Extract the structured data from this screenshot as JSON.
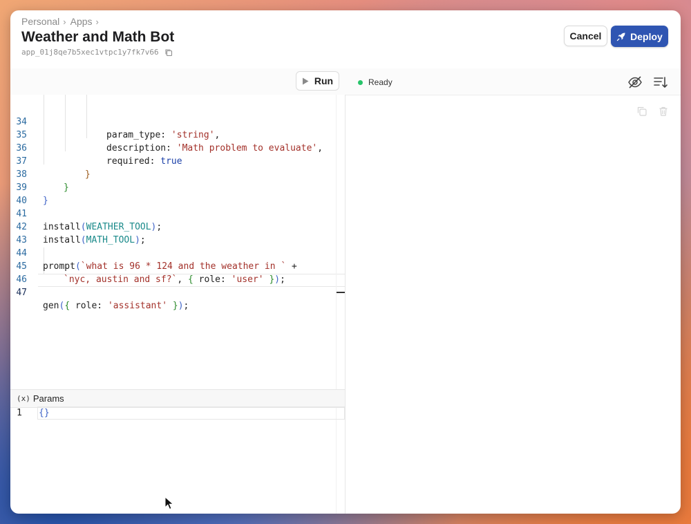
{
  "header": {
    "breadcrumbs": [
      "Personal",
      "Apps"
    ],
    "title": "Weather and Math Bot",
    "app_id": "app_01j8qe7b5xec1vtpc1y7fk7v66",
    "cancel_label": "Cancel",
    "deploy_label": "Deploy"
  },
  "toolbar": {
    "run_label": "Run",
    "status": "Ready",
    "status_color": "#27c46a"
  },
  "editor": {
    "lines": [
      {
        "num": "34",
        "code": "param_type: 'string',"
      },
      {
        "num": "35",
        "code": "description: 'Math problem to evaluate',"
      },
      {
        "num": "36",
        "code": "required: true"
      },
      {
        "num": "37",
        "code": "}"
      },
      {
        "num": "38",
        "code": "}"
      },
      {
        "num": "39",
        "code": "}"
      },
      {
        "num": "40",
        "code": ""
      },
      {
        "num": "41",
        "code": "install(WEATHER_TOOL);"
      },
      {
        "num": "42",
        "code": "install(MATH_TOOL);"
      },
      {
        "num": "43",
        "code": ""
      },
      {
        "num": "44",
        "code": "prompt(`what is 96 * 124 and the weather in ` +"
      },
      {
        "num": "45",
        "code": "`nyc, austin and sf?`, { role: 'user' });"
      },
      {
        "num": "46",
        "code": ""
      },
      {
        "num": "47",
        "code": "gen({ role: 'assistant' });"
      }
    ]
  },
  "params": {
    "title": "Params",
    "prefix_glyph": "(x)",
    "line_num": "1",
    "value": "{}"
  },
  "icons": {
    "breadcrumb_sep": "chevron-right-icon",
    "copy": "copy-icon",
    "deploy": "rocket-icon",
    "run": "play-icon",
    "visibility": "eye-off-icon",
    "sort": "sort-lines-icon",
    "output_copy": "copy-icon",
    "output_delete": "trash-icon"
  },
  "colors": {
    "accent": "#2f55b2",
    "line_number": "#2a6aa0",
    "string": "#a3312a"
  }
}
